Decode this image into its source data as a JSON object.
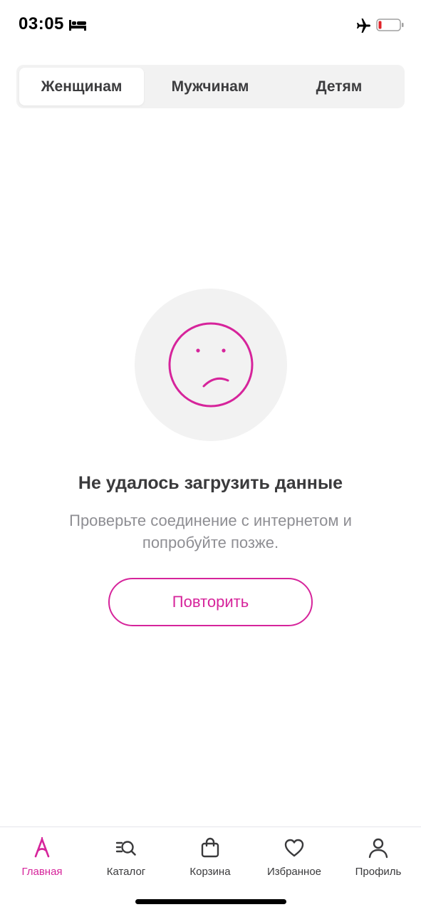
{
  "status_bar": {
    "time": "03:05",
    "icons": [
      "bed-icon",
      "airplane-icon",
      "battery-low-icon"
    ]
  },
  "tabs": [
    {
      "label": "Женщинам",
      "active": true
    },
    {
      "label": "Мужчинам",
      "active": false
    },
    {
      "label": "Детям",
      "active": false
    }
  ],
  "error": {
    "icon": "sad-face-icon",
    "title": "Не удалось загрузить данные",
    "message": "Проверьте соединение с интернетом и попробуйте позже.",
    "retry_label": "Повторить"
  },
  "bottom_nav": [
    {
      "label": "Главная",
      "icon": "home-logo-icon",
      "active": true
    },
    {
      "label": "Каталог",
      "icon": "catalog-search-icon",
      "active": false
    },
    {
      "label": "Корзина",
      "icon": "bag-icon",
      "active": false
    },
    {
      "label": "Избранное",
      "icon": "heart-icon",
      "active": false
    },
    {
      "label": "Профиль",
      "icon": "profile-icon",
      "active": false
    }
  ],
  "colors": {
    "accent": "#d6249b",
    "text_primary": "#3a3a3c",
    "text_secondary": "#8e8e93",
    "surface": "#f2f2f2",
    "battery_low": "#e0242a"
  }
}
